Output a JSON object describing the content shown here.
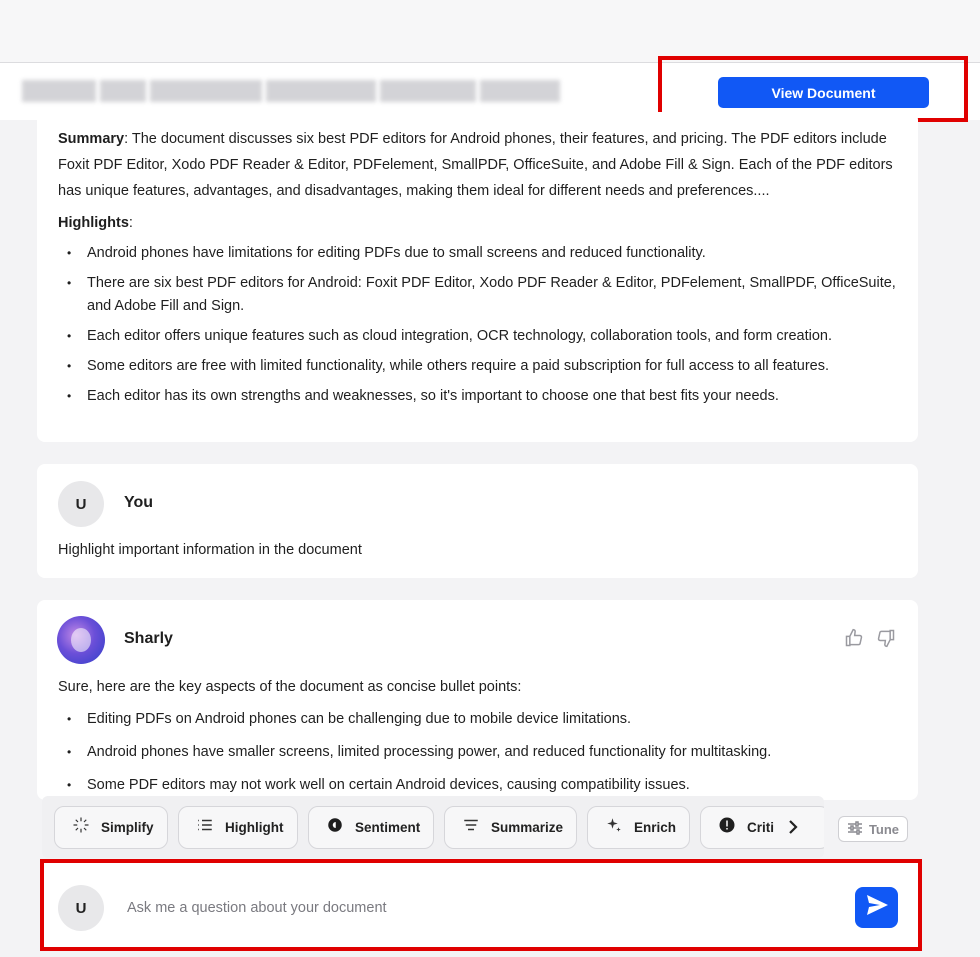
{
  "header": {
    "view_document_label": "View Document"
  },
  "summary_card": {
    "summary_label": "Summary",
    "summary_text": ": The document discusses six best PDF editors for Android phones, their features, and pricing. The PDF editors include Foxit PDF Editor, Xodo PDF Reader & Editor, PDFelement, SmallPDF, OfficeSuite, and Adobe Fill & Sign. Each of the PDF editors has unique features, advantages, and disadvantages, making them ideal for different needs and preferences....",
    "highlights_label": "Highlights",
    "highlights_colon": ":",
    "highlights": [
      "Android phones have limitations for editing PDFs due to small screens and reduced functionality.",
      "There are six best PDF editors for Android: Foxit PDF Editor, Xodo PDF Reader & Editor, PDFelement, SmallPDF, OfficeSuite, and Adobe Fill and Sign.",
      "Each editor offers unique features such as cloud integration, OCR technology, collaboration tools, and form creation.",
      "Some editors are free with limited functionality, while others require a paid subscription for full access to all features.",
      "Each editor has its own strengths and weaknesses, so it's important to choose one that best fits your needs."
    ]
  },
  "user_message": {
    "avatar_letter": "U",
    "name": "You",
    "text": "Highlight important information in the document"
  },
  "sharly_message": {
    "name": "Sharly",
    "intro": "Sure, here are the key aspects of the document as concise bullet points:",
    "bullets": [
      "Editing PDFs on Android phones can be challenging due to mobile device limitations.",
      "Android phones have smaller screens, limited processing power, and reduced functionality for multitasking.",
      "Some PDF editors may not work well on certain Android devices, causing compatibility issues."
    ]
  },
  "actions": {
    "chips": [
      "Simplify",
      "Highlight",
      "Sentiment",
      "Summarize",
      "Enrich",
      "Criti"
    ],
    "tune_label": "Tune"
  },
  "composer": {
    "avatar_letter": "U",
    "placeholder": "Ask me a question about your document"
  },
  "colors": {
    "accent": "#1158f5",
    "highlight_frame": "#e00000"
  }
}
